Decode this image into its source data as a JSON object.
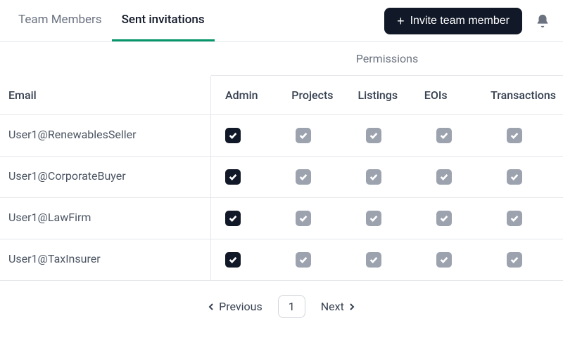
{
  "tabs": {
    "members": "Team Members",
    "invitations": "Sent invitations"
  },
  "actions": {
    "invite": "Invite team member"
  },
  "sections": {
    "permissions": "Permissions"
  },
  "columns": {
    "email": "Email",
    "admin": "Admin",
    "projects": "Projects",
    "listings": "Listings",
    "eois": "EOIs",
    "transactions": "Transactions"
  },
  "rows": [
    {
      "email": "User1@RenewablesSeller",
      "admin": true,
      "projects": true,
      "listings": true,
      "eois": true,
      "transactions": true
    },
    {
      "email": "User1@CorporateBuyer",
      "admin": true,
      "projects": true,
      "listings": true,
      "eois": true,
      "transactions": true
    },
    {
      "email": "User1@LawFirm",
      "admin": true,
      "projects": true,
      "listings": true,
      "eois": true,
      "transactions": true
    },
    {
      "email": "User1@TaxInsurer",
      "admin": true,
      "projects": true,
      "listings": true,
      "eois": true,
      "transactions": true
    }
  ],
  "pagination": {
    "previous": "Previous",
    "next": "Next",
    "page": "1"
  }
}
